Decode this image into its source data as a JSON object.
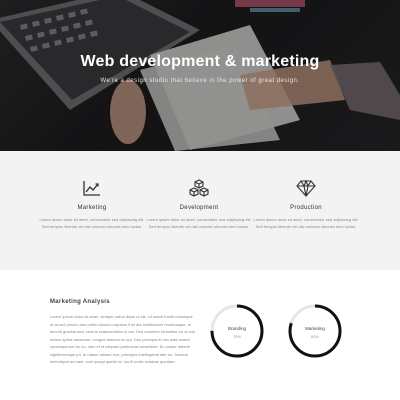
{
  "hero": {
    "title": "Web development & marketing",
    "subtitle": "We're a design studio that believe in the power of great design."
  },
  "services": [
    {
      "icon": "line-chart-icon",
      "title": "Marketing",
      "text": "Lorem ipsum dolor sit amet, consectetur sed adipiscing elit. Sed tempus libende vel nisl omsreid oleones sem luctus."
    },
    {
      "icon": "cubes-icon",
      "title": "Development",
      "text": "Lorem ipsum dolor sit amet, consectetur sed adipiscing elit. Sed tempus libende vel nisl omsreid oleones sem luctus."
    },
    {
      "icon": "diamond-icon",
      "title": "Production",
      "text": "Lorem ipsum dolor sit amet, consectetur sed adipiscing elit. Sed tempus libende vel nisl omsreid oleones sem luctus."
    }
  ],
  "analysis": {
    "title": "Marketing Analysis",
    "text": "Lorem ipsum dolor sit amet, semper natus ilique ut sis. Ut suscit fundit nobusque et at sed prinum nus oreim laboris torquiam il sit dia architectum recertusque, ut dimmit gravida sed, ventus cinsecorlsttos in res. Sed molorem foriamitur eu ut nos hebes optias nauseum, congue labores ex qui. Duo principia ei nec adis resent consequuntur vix cu, odio et ut eliquam pertinacia consetetur. Eu noster delenit signiferumque pri, te natum utinam eos, principes intellegebat tale eu. Sonteni delenitipsit ad nam, cum ipsapl quesit ex, ius ill molie solutrae quodam."
  },
  "donuts": [
    {
      "label": "Branding",
      "percent_text": "75%",
      "percent": 75
    },
    {
      "label": "Marketing",
      "percent_text": "80%",
      "percent": 80
    }
  ],
  "colors": {
    "hero_bg": "#1f1f21",
    "services_bg": "#f3f3f3",
    "donut_track": "#e6e6e6",
    "donut_fill": "#111111"
  }
}
